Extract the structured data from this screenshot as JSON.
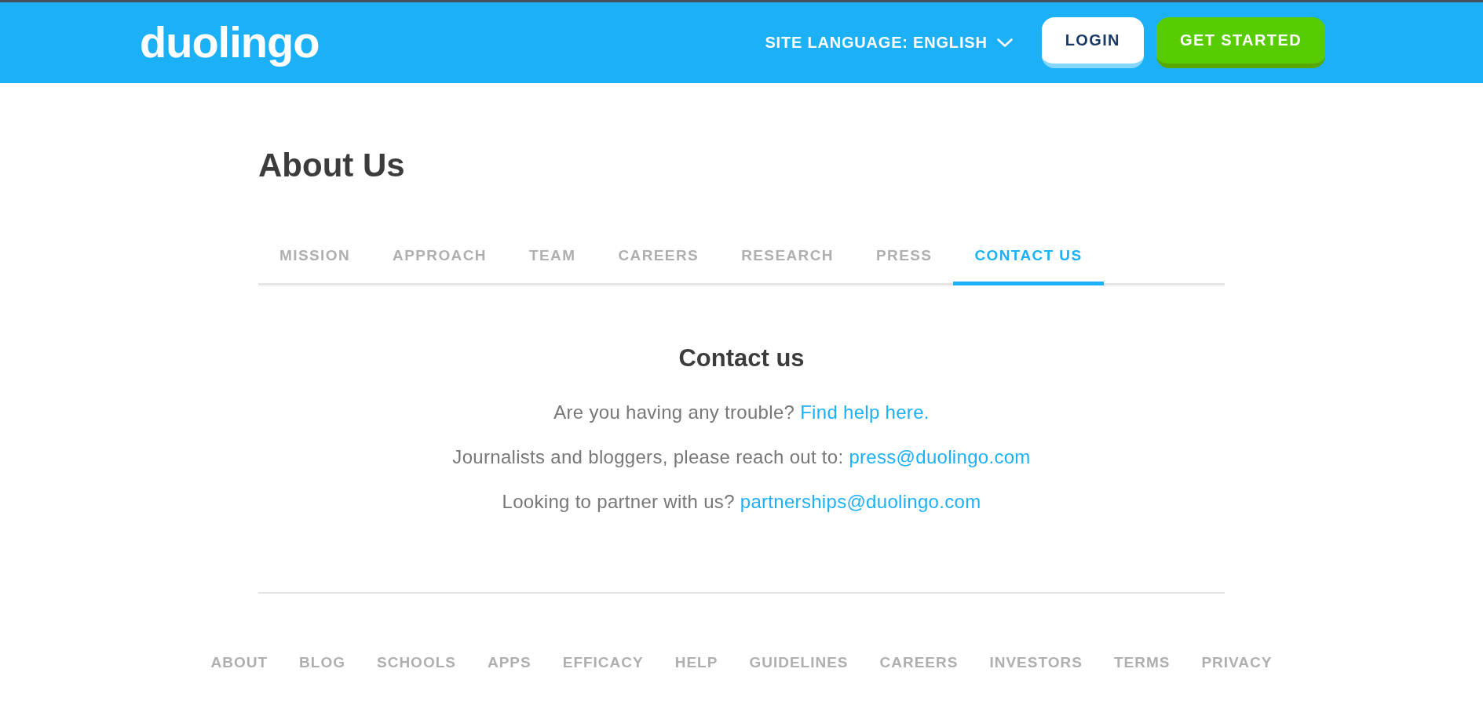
{
  "header": {
    "logo": "duolingo",
    "site_language": "SITE LANGUAGE: ENGLISH",
    "login_button": "LOGIN",
    "get_started_button": "GET STARTED"
  },
  "page_title": "About Us",
  "tabs": [
    {
      "label": "MISSION",
      "selected": false
    },
    {
      "label": "APPROACH",
      "selected": false
    },
    {
      "label": "TEAM",
      "selected": false
    },
    {
      "label": "CAREERS",
      "selected": false
    },
    {
      "label": "RESEARCH",
      "selected": false
    },
    {
      "label": "PRESS",
      "selected": false
    },
    {
      "label": "CONTACT US",
      "selected": true
    }
  ],
  "contact": {
    "heading": "Contact us",
    "lines": [
      {
        "text": "Are you having any trouble?",
        "link": "Find help here."
      },
      {
        "text": "Journalists and bloggers, please reach out to:",
        "link": "press@duolingo.com"
      },
      {
        "text": "Looking to partner with us?",
        "link": "partnerships@duolingo.com"
      }
    ]
  },
  "footer": {
    "links": [
      "ABOUT",
      "BLOG",
      "SCHOOLS",
      "APPS",
      "EFFICACY",
      "HELP",
      "GUIDELINES",
      "CAREERS",
      "INVESTORS",
      "TERMS",
      "PRIVACY"
    ]
  }
}
